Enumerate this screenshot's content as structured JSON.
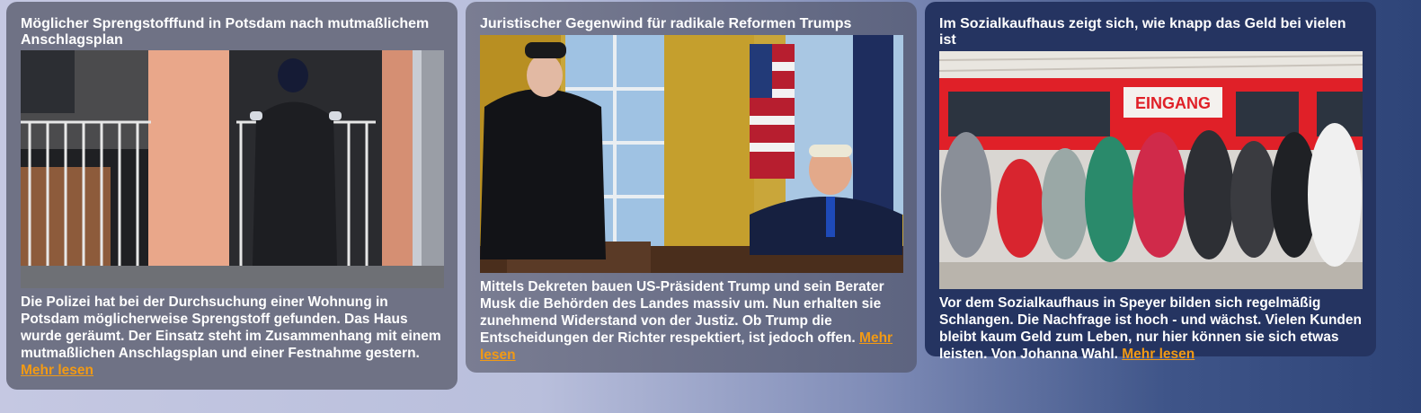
{
  "cards": [
    {
      "title": "Möglicher Sprengstofffund in Potsdam nach mutmaßlichem Anschlagsplan",
      "text": "Die Polizei hat bei der Durchsuchung einer Wohnung in Potsdam möglicherweise Sprengstoff gefunden. Das Haus wurde geräumt. Der Einsatz steht im Zusammenhang mit einem mutmaßlichen Anschlagsplan und einer Festnahme gestern.",
      "more": "Mehr lesen"
    },
    {
      "title": "Juristischer Gegenwind für radikale Reformen Trumps",
      "text": "Mittels Dekreten bauen US-Präsident Trump und sein Berater Musk die Behörden des Landes massiv um. Nun erhalten sie zunehmend Widerstand von der Justiz. Ob Trump die Entscheidungen der Richter respektiert, ist jedoch offen.",
      "more": "Mehr lesen"
    },
    {
      "title": "Im Sozialkaufhaus zeigt sich, wie knapp das Geld bei vielen ist",
      "text": "Vor dem Sozialkaufhaus in Speyer bilden sich regelmäßig Schlangen. Die Nachfrage ist hoch - und wächst. Vielen Kunden bleibt kaum Geld zum Leben, nur hier können sie sich etwas leisten. Von Johanna Wahl.",
      "more": "Mehr lesen",
      "sign_text": "EINGANG"
    }
  ],
  "colors": {
    "link": "#f29a14"
  }
}
